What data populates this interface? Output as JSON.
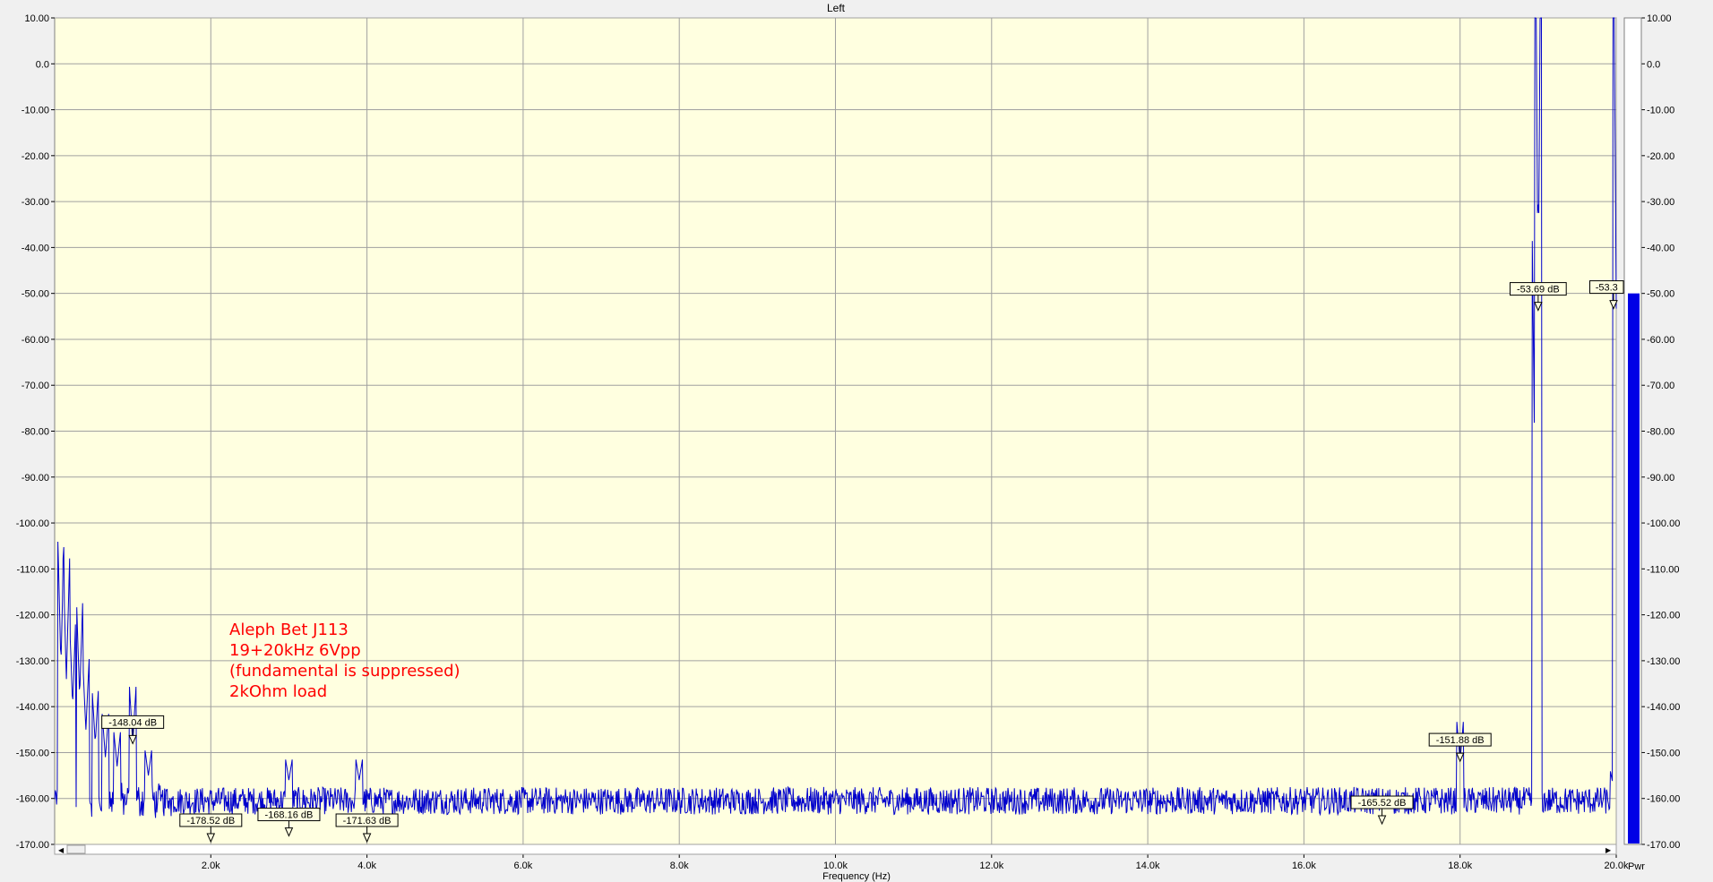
{
  "chart_data": {
    "type": "line",
    "title": "Left",
    "xlabel": "Frequency (Hz)",
    "ylabel": "",
    "xlim": [
      0,
      20000
    ],
    "ylim": [
      -170,
      10
    ],
    "x_ticks": [
      2000,
      4000,
      6000,
      8000,
      10000,
      12000,
      14000,
      16000,
      18000,
      20000
    ],
    "x_tick_labels": [
      "2.0k",
      "4.0k",
      "6.0k",
      "8.0k",
      "10.0k",
      "12.0k",
      "14.0k",
      "16.0k",
      "18.0k",
      "20.0k"
    ],
    "y_ticks": [
      10,
      0,
      -10,
      -20,
      -30,
      -40,
      -50,
      -60,
      -70,
      -80,
      -90,
      -100,
      -110,
      -120,
      -130,
      -140,
      -150,
      -160,
      -170
    ],
    "y_tick_labels": [
      "10.00",
      "0.0",
      "-10.00",
      "-20.00",
      "-30.00",
      "-40.00",
      "-50.00",
      "-60.00",
      "-70.00",
      "-80.00",
      "-90.00",
      "-100.00",
      "-110.00",
      "-120.00",
      "-130.00",
      "-140.00",
      "-150.00",
      "-160.00",
      "-170.00"
    ],
    "grid": true,
    "colors": {
      "plot_bg": "#ffffe0",
      "grid": "#a0a0a0",
      "trace": "#0000cc",
      "annotation": "#ff0000",
      "meter_fill": "#0000e6"
    },
    "noise_floor": -160.5,
    "peaks": [
      {
        "x": 80,
        "y": -131
      },
      {
        "x": 150,
        "y": -134
      },
      {
        "x": 230,
        "y": -140
      },
      {
        "x": 320,
        "y": -138
      },
      {
        "x": 400,
        "y": -145
      },
      {
        "x": 520,
        "y": -148
      },
      {
        "x": 650,
        "y": -151
      },
      {
        "x": 800,
        "y": -153
      },
      {
        "x": 1000,
        "y": -148.04
      },
      {
        "x": 1200,
        "y": -155
      },
      {
        "x": 3000,
        "y": -156
      },
      {
        "x": 3900,
        "y": -156
      },
      {
        "x": 18000,
        "y": -151.88
      },
      {
        "x": 18960,
        "y": -94
      },
      {
        "x": 19000,
        "y": -53.69
      },
      {
        "x": 19960,
        "y": -157
      },
      {
        "x": 20000,
        "y": -53.3
      }
    ],
    "markers": [
      {
        "label": "-148.04 dB",
        "x": 1000,
        "y": -148.04
      },
      {
        "label": "-178.52 dB",
        "x": 2000,
        "y": -178.52
      },
      {
        "label": "-168.16 dB",
        "x": 3000,
        "y": -168.16
      },
      {
        "label": "-171.63 dB",
        "x": 4000,
        "y": -171.63
      },
      {
        "label": "-151.88 dB",
        "x": 18000,
        "y": -151.88
      },
      {
        "label": "-53.69 dB",
        "x": 19000,
        "y": -53.69
      },
      {
        "label": "-53.3",
        "x": 20000,
        "y": -53.3
      },
      {
        "label": "-165.52 dB",
        "x": 17000,
        "y": -165.52
      }
    ],
    "annotation_lines": [
      "Aleph Bet J113",
      "19+20kHz 6Vpp",
      "(fundamental is suppressed)",
      "2kOhm load"
    ],
    "meter": {
      "label": "Pwr",
      "value": -50
    }
  }
}
